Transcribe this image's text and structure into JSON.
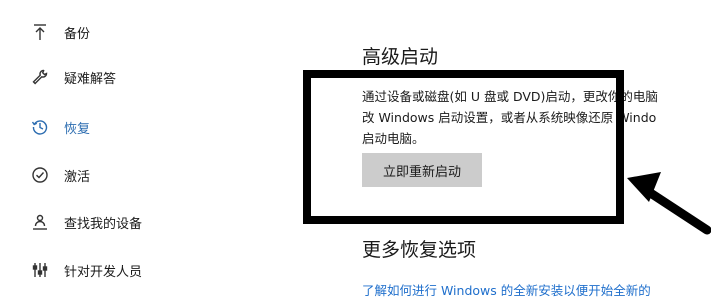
{
  "sidebar": {
    "items": [
      {
        "label": "备份",
        "icon": "upload-arrow-icon",
        "active": false
      },
      {
        "label": "疑难解答",
        "icon": "wrench-icon",
        "active": false
      },
      {
        "label": "恢复",
        "icon": "history-icon",
        "active": true
      },
      {
        "label": "激活",
        "icon": "check-circle-icon",
        "active": false
      },
      {
        "label": "查找我的设备",
        "icon": "person-pin-icon",
        "active": false
      },
      {
        "label": "针对开发人员",
        "icon": "developer-tools-icon",
        "active": false
      }
    ]
  },
  "advanced_startup": {
    "title": "高级启动",
    "description_lines": [
      "通过设备或磁盘(如 U 盘或 DVD)启动，更改你的电脑",
      "改 Windows 启动设置，或者从系统映像还原 Windo",
      "启动电脑。"
    ],
    "button_label": "立即重新启动"
  },
  "more_recovery": {
    "title": "更多恢复选项",
    "link_text": "了解如何进行 Windows 的全新安装以便开始全新的"
  },
  "colors": {
    "accent": "#2b6cb0",
    "link": "#1f6fcc",
    "button_bg": "#cccccc",
    "annotation": "#000000"
  }
}
